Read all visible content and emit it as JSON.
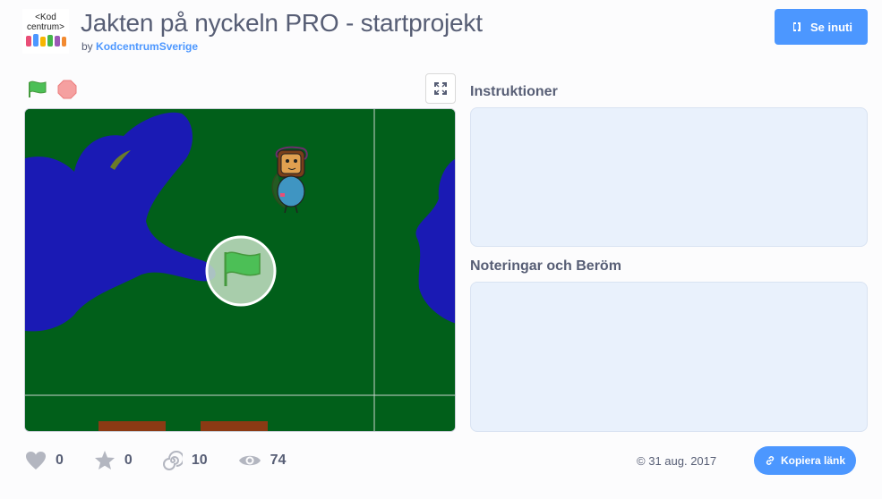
{
  "header": {
    "logo_text_top": "<Kod",
    "logo_text_bottom": "centrum>",
    "title": "Jakten på nyckeln PRO - startprojekt",
    "by_label": "by",
    "author": "KodcentrumSverige",
    "see_inside_label": "Se inuti"
  },
  "player": {
    "green_flag_icon": "green-flag-icon",
    "stop_icon": "stop-icon",
    "fullscreen_icon": "fullscreen-icon",
    "stage_colors": {
      "grass": "#015f1a",
      "water": "#1a1ab4",
      "path": "#8b3a14"
    }
  },
  "sidebar": {
    "instructions_label": "Instruktioner",
    "notes_label": "Noteringar och Beröm",
    "panel_color": "#e9f1fc"
  },
  "stats": {
    "loves": "0",
    "favorites": "0",
    "remixes": "10",
    "views": "74"
  },
  "footer": {
    "date": "31 aug. 2017",
    "copy_link_label": "Kopiera länk"
  },
  "colors": {
    "accent": "#4c97ff",
    "text": "#575e75"
  }
}
